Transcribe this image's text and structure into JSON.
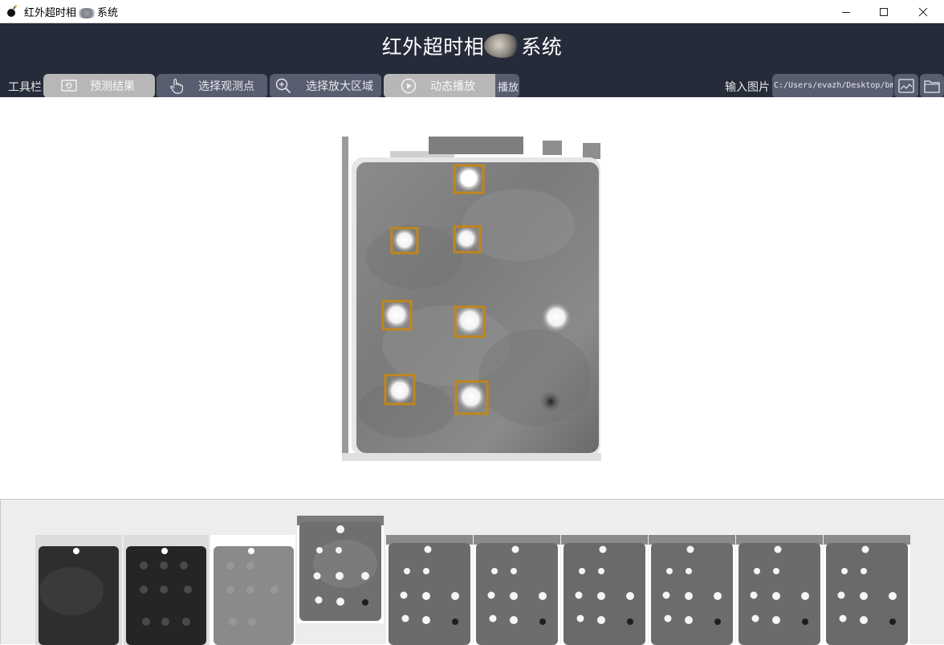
{
  "window": {
    "title": "红外超时相      系统",
    "buttons": [
      "minimize",
      "maximize",
      "close"
    ]
  },
  "header": {
    "title_prefix": "红外超时相",
    "title_suffix": "系统"
  },
  "toolbar": {
    "label": "工具栏",
    "buttons": [
      {
        "label": "预测结果",
        "icon": "refresh-screen-icon"
      },
      {
        "label": "选择观测点",
        "icon": "hand-pointer-icon"
      },
      {
        "label": "选择放大区域",
        "icon": "zoom-in-icon"
      },
      {
        "label": "动态播放",
        "icon": "play-circle-icon"
      }
    ],
    "play_label": "播放"
  },
  "input": {
    "label": "输入图片",
    "path": "C:/Users/evazh/Desktop/bmp"
  },
  "colors": {
    "header_bg": "#262b3a",
    "button_bg": "#585d70",
    "button_active_bg": "#b7b7b7",
    "box_color": "#c0861d",
    "strip_bg": "#ededed"
  },
  "thumbnails": [
    {
      "label": "thumb-1",
      "dark": true,
      "style": "very-dark"
    },
    {
      "label": "thumb-2",
      "dark": true,
      "style": "dark"
    },
    {
      "label": "thumb-3",
      "dark": false,
      "style": "uniform-gray"
    },
    {
      "label": "thumb-4",
      "style": "selected"
    },
    {
      "label": "thumb-5"
    },
    {
      "label": "thumb-6"
    },
    {
      "label": "thumb-7"
    },
    {
      "label": "thumb-8"
    },
    {
      "label": "thumb-9"
    },
    {
      "label": "thumb-10"
    }
  ]
}
